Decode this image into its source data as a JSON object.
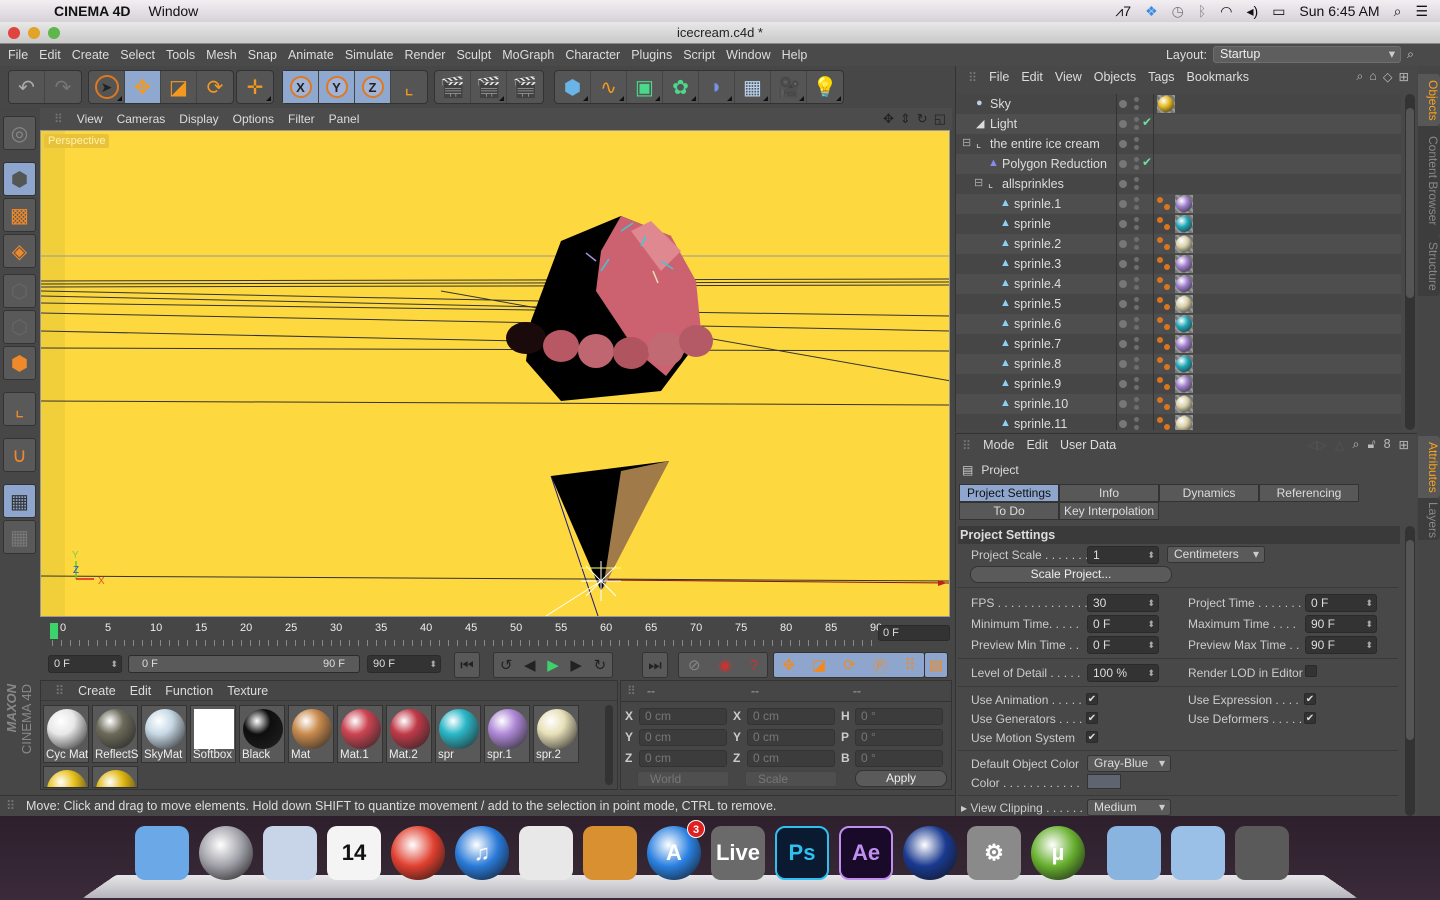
{
  "mac_menubar": {
    "app_name": "CINEMA 4D",
    "menus": [
      "Window"
    ],
    "status": {
      "adobe_count": "7",
      "clock": "Sun 6:45 AM"
    }
  },
  "window": {
    "title": "icecream.c4d *"
  },
  "app_menu": {
    "items": [
      "File",
      "Edit",
      "Create",
      "Select",
      "Tools",
      "Mesh",
      "Snap",
      "Animate",
      "Simulate",
      "Render",
      "Sculpt",
      "MoGraph",
      "Character",
      "Plugins",
      "Script",
      "Window",
      "Help"
    ],
    "layout_label": "Layout:",
    "layout_value": "Startup"
  },
  "toolbar": {
    "groups": [
      {
        "name": "history",
        "buttons": [
          "undo",
          "redo"
        ]
      },
      {
        "name": "tools",
        "buttons": [
          "live-selection",
          "move",
          "scale",
          "rotate"
        ]
      },
      {
        "name": "last-tool",
        "buttons": [
          "move-last"
        ]
      },
      {
        "name": "axis-lock",
        "buttons": [
          "X",
          "Y",
          "Z",
          "world-coordinates"
        ]
      },
      {
        "name": "render",
        "buttons": [
          "render-view",
          "render-picture-viewer",
          "render-settings"
        ]
      },
      {
        "name": "create",
        "buttons": [
          "cube",
          "spline",
          "nurbs",
          "array",
          "deformer",
          "floor",
          "camera",
          "light"
        ]
      }
    ],
    "axis_labels": [
      "X",
      "Y",
      "Z"
    ]
  },
  "viewport": {
    "menu": [
      "View",
      "Cameras",
      "Display",
      "Options",
      "Filter",
      "Panel"
    ],
    "camera_label": "Perspective",
    "axis_labels": {
      "x": "X",
      "y": "Y",
      "z": "Z"
    },
    "background_color": "#fdd83f"
  },
  "left_toolbar": {
    "buttons": [
      "make-editable",
      "model-mode",
      "texture-mode",
      "workplane-mode",
      "points-mode",
      "edges-mode",
      "polygons-mode",
      "axis-mode",
      "tweak-magnet",
      "locked-workplane",
      "planar-workplane"
    ]
  },
  "timeline": {
    "ticks": [
      "0",
      "5",
      "10",
      "15",
      "20",
      "25",
      "30",
      "35",
      "40",
      "45",
      "50",
      "55",
      "60",
      "65",
      "70",
      "75",
      "80",
      "85",
      "90"
    ],
    "current_frame": "0 F",
    "start_field": "0 F",
    "range_start": "0 F",
    "range_end": "90 F",
    "end_field": "90 F"
  },
  "materials": {
    "menu": [
      "Create",
      "Edit",
      "Function",
      "Texture"
    ],
    "items": [
      {
        "name": "Cyc Mat",
        "color": "#e8e8e8"
      },
      {
        "name": "ReflectS",
        "color": "#6b6a5a"
      },
      {
        "name": "SkyMat",
        "color": "#c7d9e6"
      },
      {
        "name": "Softbox",
        "color": "#ffffff"
      },
      {
        "name": "Black",
        "color": "#0e0e0e"
      },
      {
        "name": "Mat",
        "color": "#c98a4d"
      },
      {
        "name": "Mat.1",
        "color": "#cc4452"
      },
      {
        "name": "Mat.2",
        "color": "#c03a48"
      },
      {
        "name": "spr",
        "color": "#2ab7c7"
      },
      {
        "name": "spr.1",
        "color": "#b08ad8"
      },
      {
        "name": "spr.2",
        "color": "#e8e0b8"
      }
    ],
    "second_row": [
      {
        "color": "#e8c21a"
      },
      {
        "color": "#e0b810"
      }
    ],
    "brand_top": "MAXON",
    "brand_bottom": "CINEMA 4D"
  },
  "coordinates": {
    "headers": [
      "--",
      "--",
      "--"
    ],
    "position": [
      {
        "axis": "X",
        "value": "0 cm"
      },
      {
        "axis": "Y",
        "value": "0 cm"
      },
      {
        "axis": "Z",
        "value": "0 cm"
      }
    ],
    "size": [
      {
        "axis": "X",
        "value": "0 cm"
      },
      {
        "axis": "Y",
        "value": "0 cm"
      },
      {
        "axis": "Z",
        "value": "0 cm"
      }
    ],
    "rotation": [
      {
        "axis": "H",
        "value": "0 °"
      },
      {
        "axis": "P",
        "value": "0 °"
      },
      {
        "axis": "B",
        "value": "0 °"
      }
    ],
    "space_dropdown": "World",
    "mode_dropdown": "Scale",
    "apply_label": "Apply"
  },
  "status_bar": {
    "text": "Move: Click and drag to move elements. Hold down SHIFT to quantize movement / add to the selection in point mode, CTRL to remove."
  },
  "object_manager": {
    "menu": [
      "File",
      "Edit",
      "View",
      "Objects",
      "Tags",
      "Bookmarks"
    ],
    "objects": [
      {
        "name": "Sky",
        "indent": 0,
        "check": false,
        "tags": [
          "#e4b81e"
        ]
      },
      {
        "name": "Light",
        "indent": 0,
        "check": true,
        "tags": []
      },
      {
        "name": "the entire ice cream",
        "indent": 0,
        "check": false,
        "tags": [],
        "expanded": true
      },
      {
        "name": "Polygon Reduction",
        "indent": 1,
        "check": true,
        "tags": []
      },
      {
        "name": "allsprinkles",
        "indent": 1,
        "check": false,
        "tags": [],
        "expanded": true
      },
      {
        "name": "sprinle.1",
        "indent": 2,
        "check": false,
        "tags": [
          "#a07fcc"
        ]
      },
      {
        "name": "sprinle",
        "indent": 2,
        "check": false,
        "tags": [
          "#1fa8b8"
        ]
      },
      {
        "name": "sprinle.2",
        "indent": 2,
        "check": false,
        "tags": [
          "#d8d0a8"
        ]
      },
      {
        "name": "sprinle.3",
        "indent": 2,
        "check": false,
        "tags": [
          "#a07fcc"
        ]
      },
      {
        "name": "sprinle.4",
        "indent": 2,
        "check": false,
        "tags": [
          "#a07fcc"
        ]
      },
      {
        "name": "sprinle.5",
        "indent": 2,
        "check": false,
        "tags": [
          "#d8d0a8"
        ]
      },
      {
        "name": "sprinle.6",
        "indent": 2,
        "check": false,
        "tags": [
          "#1fa8b8"
        ]
      },
      {
        "name": "sprinle.7",
        "indent": 2,
        "check": false,
        "tags": [
          "#a07fcc"
        ]
      },
      {
        "name": "sprinle.8",
        "indent": 2,
        "check": false,
        "tags": [
          "#1fa8b8"
        ]
      },
      {
        "name": "sprinle.9",
        "indent": 2,
        "check": false,
        "tags": [
          "#a07fcc"
        ]
      },
      {
        "name": "sprinle.10",
        "indent": 2,
        "check": false,
        "tags": [
          "#d8d0a8"
        ]
      },
      {
        "name": "sprinle.11",
        "indent": 2,
        "check": false,
        "tags": [
          "#d8d0a8"
        ]
      }
    ],
    "side_tabs": [
      "Objects",
      "Content Browser",
      "Structure"
    ]
  },
  "attributes": {
    "menu": [
      "Mode",
      "Edit",
      "User Data"
    ],
    "object_label": "Project",
    "tabs_row1": [
      "Project Settings",
      "Info",
      "Dynamics",
      "Referencing"
    ],
    "tabs_row2": [
      "To Do",
      "Key Interpolation"
    ],
    "selected_tab": "Project Settings",
    "section_title": "Project Settings",
    "project_scale": {
      "label": "Project Scale . . . . . . .",
      "value": "1",
      "unit": "Centimeters"
    },
    "scale_project_button": "Scale Project...",
    "fps": {
      "label": "FPS . . . . . . . . . . . . . . .",
      "value": "30"
    },
    "project_time": {
      "label": "Project Time . . . . . . .",
      "value": "0 F"
    },
    "min_time": {
      "label": "Minimum Time. . . . .",
      "value": "0 F"
    },
    "max_time": {
      "label": "Maximum Time . . . .",
      "value": "90 F"
    },
    "preview_min": {
      "label": "Preview Min Time . .",
      "value": "0 F"
    },
    "preview_max": {
      "label": "Preview Max Time . .",
      "value": "90 F"
    },
    "lod": {
      "label": "Level of Detail . . . . .",
      "value": "100 %"
    },
    "render_lod": {
      "label": "Render LOD in Editor",
      "checked": false
    },
    "use_animation": {
      "label": "Use Animation . . . . .",
      "checked": true
    },
    "use_expression": {
      "label": "Use Expression . . . .",
      "checked": true
    },
    "use_generators": {
      "label": "Use Generators . . . .",
      "checked": true
    },
    "use_deformers": {
      "label": "Use Deformers . . . . .",
      "checked": true
    },
    "use_motion": {
      "label": "Use Motion System",
      "checked": true
    },
    "default_color": {
      "label": "Default Object Color",
      "value": "Gray-Blue"
    },
    "color": {
      "label": "Color . . . . . . . . . . . .",
      "swatch": "#5e6470"
    },
    "view_clipping": {
      "label": "View Clipping . . . . . .",
      "value": "Medium"
    },
    "side_tabs": [
      "Attributes",
      "Layers"
    ],
    "check_glyph": "✔"
  },
  "dock": {
    "apps": [
      {
        "name": "Finder",
        "label": "",
        "color": "#6aa8e8"
      },
      {
        "name": "Launchpad",
        "label": "",
        "color": "#a0a0a8"
      },
      {
        "name": "Mail",
        "label": "",
        "color": "#c8d4e8"
      },
      {
        "name": "Calendar",
        "label": "14",
        "color": "#f4f4f4"
      },
      {
        "name": "Chrome",
        "label": "",
        "color": "#e04030"
      },
      {
        "name": "iTunes",
        "label": "♫",
        "color": "#2a7ad8"
      },
      {
        "name": "MIDI",
        "label": "",
        "color": "#e8e8e8"
      },
      {
        "name": "iPhoto",
        "label": "",
        "color": "#d89030"
      },
      {
        "name": "App Store",
        "label": "A",
        "color": "#2a80e0",
        "badge": "3"
      },
      {
        "name": "Ableton Live",
        "label": "Live",
        "color": "#6a6a6a"
      },
      {
        "name": "Photoshop",
        "label": "Ps",
        "color": "#0a1a30"
      },
      {
        "name": "After Effects",
        "label": "Ae",
        "color": "#1a0a2a"
      },
      {
        "name": "Cinema 4D",
        "label": "",
        "color": "#1a3a90"
      },
      {
        "name": "System Preferences",
        "label": "⚙",
        "color": "#8a8a8a"
      },
      {
        "name": "uTorrent",
        "label": "µ",
        "color": "#68b030"
      },
      {
        "name": "Applications",
        "label": "",
        "color": "#8ab4e0"
      },
      {
        "name": "Documents",
        "label": "",
        "color": "#9ac0e8"
      },
      {
        "name": "Trash",
        "label": "",
        "color": "#5a5a5a"
      }
    ]
  }
}
